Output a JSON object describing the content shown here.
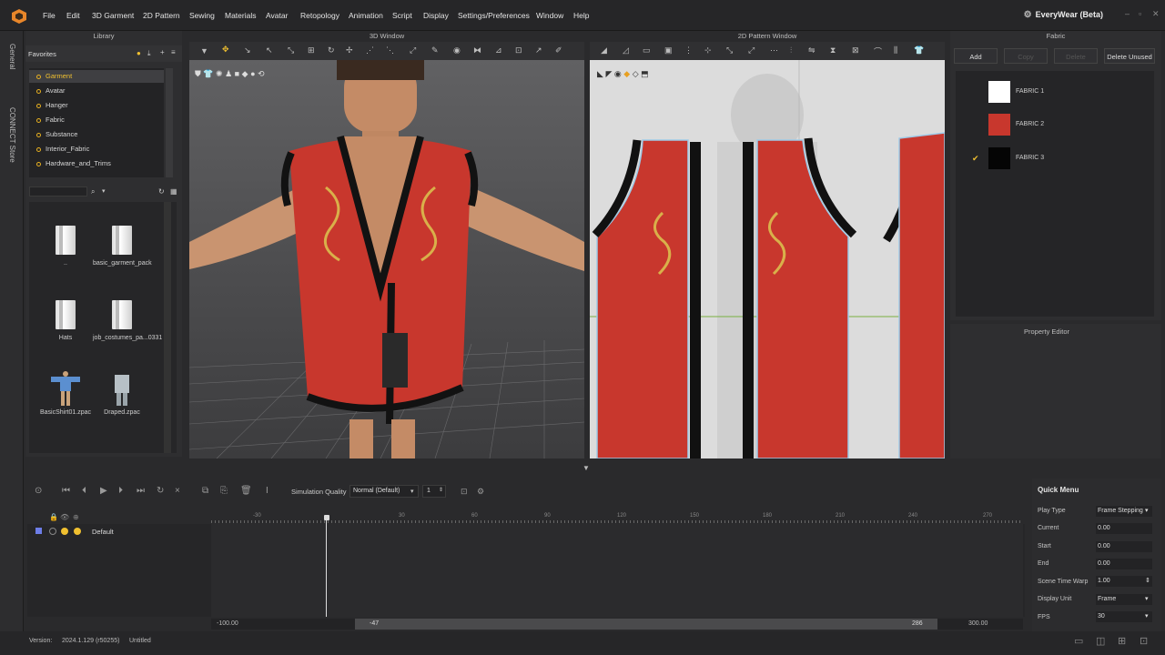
{
  "app": {
    "brand": "EveryWear (Beta)"
  },
  "menu": [
    "File",
    "Edit",
    "3D Garment",
    "2D Pattern",
    "Sewing",
    "Materials",
    "Avatar",
    "Retopology",
    "Animation",
    "Script",
    "Display",
    "Settings/Preferences",
    "Window",
    "Help"
  ],
  "side_tabs": {
    "general": "General",
    "connect": "CONNECT Store"
  },
  "library": {
    "title": "Library",
    "favorites_label": "Favorites",
    "favorites": [
      "Garment",
      "Avatar",
      "Hanger",
      "Fabric",
      "Substance",
      "Interior_Fabric",
      "Hardware_and_Trims"
    ],
    "selected_index": 0,
    "files": [
      "..",
      "basic_garment_pack",
      "Hats",
      "job_costumes_pa...0331",
      "BasicShirt01.zpac",
      "Draped.zpac"
    ]
  },
  "window3d": {
    "title": "3D Window"
  },
  "window2d": {
    "title": "2D Pattern Window"
  },
  "fabric": {
    "title": "Fabric",
    "buttons": {
      "add": "Add",
      "copy": "Copy",
      "delete": "Delete",
      "delete_unused": "Delete Unused"
    },
    "items": [
      {
        "name": "FABRIC 1",
        "color": "#ffffff",
        "checked": false
      },
      {
        "name": "FABRIC 2",
        "color": "#c8372d",
        "checked": false
      },
      {
        "name": "FABRIC 3",
        "color": "#050505",
        "checked": true
      }
    ]
  },
  "property": {
    "title": "Property Editor"
  },
  "timeline": {
    "sim_label": "Simulation Quality",
    "sim_value": "Normal (Default)",
    "step_value": "1",
    "track": "Default",
    "ticks": [
      "-30",
      "30",
      "60",
      "90",
      "120",
      "150",
      "180",
      "210",
      "240",
      "270"
    ],
    "range_min": "-100.00",
    "range_start": "-47",
    "range_end": "286",
    "range_max": "300.00"
  },
  "quick": {
    "title": "Quick Menu",
    "rows": [
      {
        "label": "Play Type",
        "value": "Frame Stepping"
      },
      {
        "label": "Current",
        "value": "0.00"
      },
      {
        "label": "Start",
        "value": "0.00"
      },
      {
        "label": "End",
        "value": "0.00"
      },
      {
        "label": "Scene Time Warp",
        "value": "1.00"
      },
      {
        "label": "Display Unit",
        "value": "Frame"
      },
      {
        "label": "FPS",
        "value": "30"
      }
    ]
  },
  "status": {
    "version_label": "Version:",
    "version": "2024.1.129 (r50255)",
    "file": "Untitled"
  },
  "colors": {
    "accent": "#f0c030",
    "garment_red": "#c8372d",
    "trim": "#101010"
  }
}
